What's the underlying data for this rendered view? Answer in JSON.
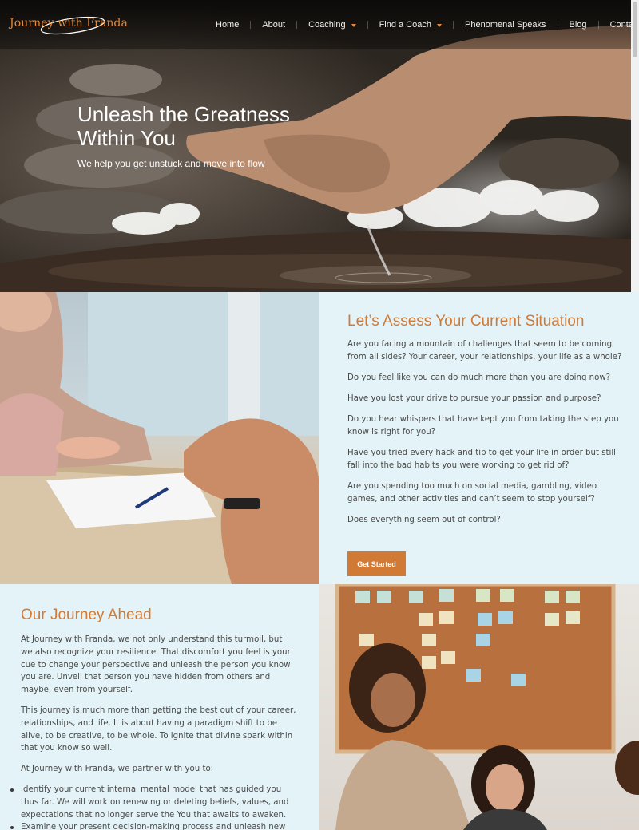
{
  "site": {
    "logo_text": "Journey with Franda"
  },
  "nav": {
    "items": [
      {
        "label": "Home",
        "has_dropdown": false
      },
      {
        "label": "About",
        "has_dropdown": false
      },
      {
        "label": "Coaching",
        "has_dropdown": true
      },
      {
        "label": "Find a Coach",
        "has_dropdown": true
      },
      {
        "label": "Phenomenal Speaks",
        "has_dropdown": false
      },
      {
        "label": "Blog",
        "has_dropdown": false
      },
      {
        "label": "Contact",
        "has_dropdown": false
      }
    ],
    "caret_color": "#e08a3e"
  },
  "hero": {
    "title": "Unleash the Greatness Within You",
    "subtitle": "We help you get unstuck and move into flow"
  },
  "assess": {
    "title": "Let’s Assess Your Current Situation",
    "questions": [
      "Are you facing a mountain of challenges that seem to be coming from all sides? Your career, your relationships, your life as a whole?",
      "Do you feel like you can do much more than you are doing now?",
      "Have you lost your drive to pursue your passion and purpose?",
      "Do you hear whispers that have kept you from taking the step you know is right for you?",
      "Have you tried every hack and tip to get your life in order but still fall into the bad habits you were working to get rid of?",
      "Are you spending too much on social media, gambling, video games, and other activities and can’t seem to stop yourself?",
      "Does everything seem out of control?"
    ],
    "button_label": "Get Started"
  },
  "journey": {
    "title": "Our Journey Ahead",
    "paragraphs": [
      "At Journey with Franda, we not only understand this turmoil, but we also recognize your resilience. That discomfort you feel is your cue to change your perspective and unleash the person you know you are. Unveil that person you have hidden from others and maybe, even from yourself.",
      "This journey is much more than getting the best out of your career, relationships, and life. It is about having a paradigm shift to be alive, to be creative, to be whole. To ignite that divine spark within that you know so well.",
      "At Journey with Franda, we partner with you to:"
    ],
    "bullets": [
      "Identify your current internal mental model that has guided you thus far. We will work on renewing or deleting beliefs, values, and expectations that no longer serve the You that awaits to awaken.",
      "Examine your present decision-making process and unleash new"
    ]
  },
  "colors": {
    "accent": "#d07a36",
    "panel_bg": "#e4f3f7",
    "body_text": "#4a4a4a"
  }
}
